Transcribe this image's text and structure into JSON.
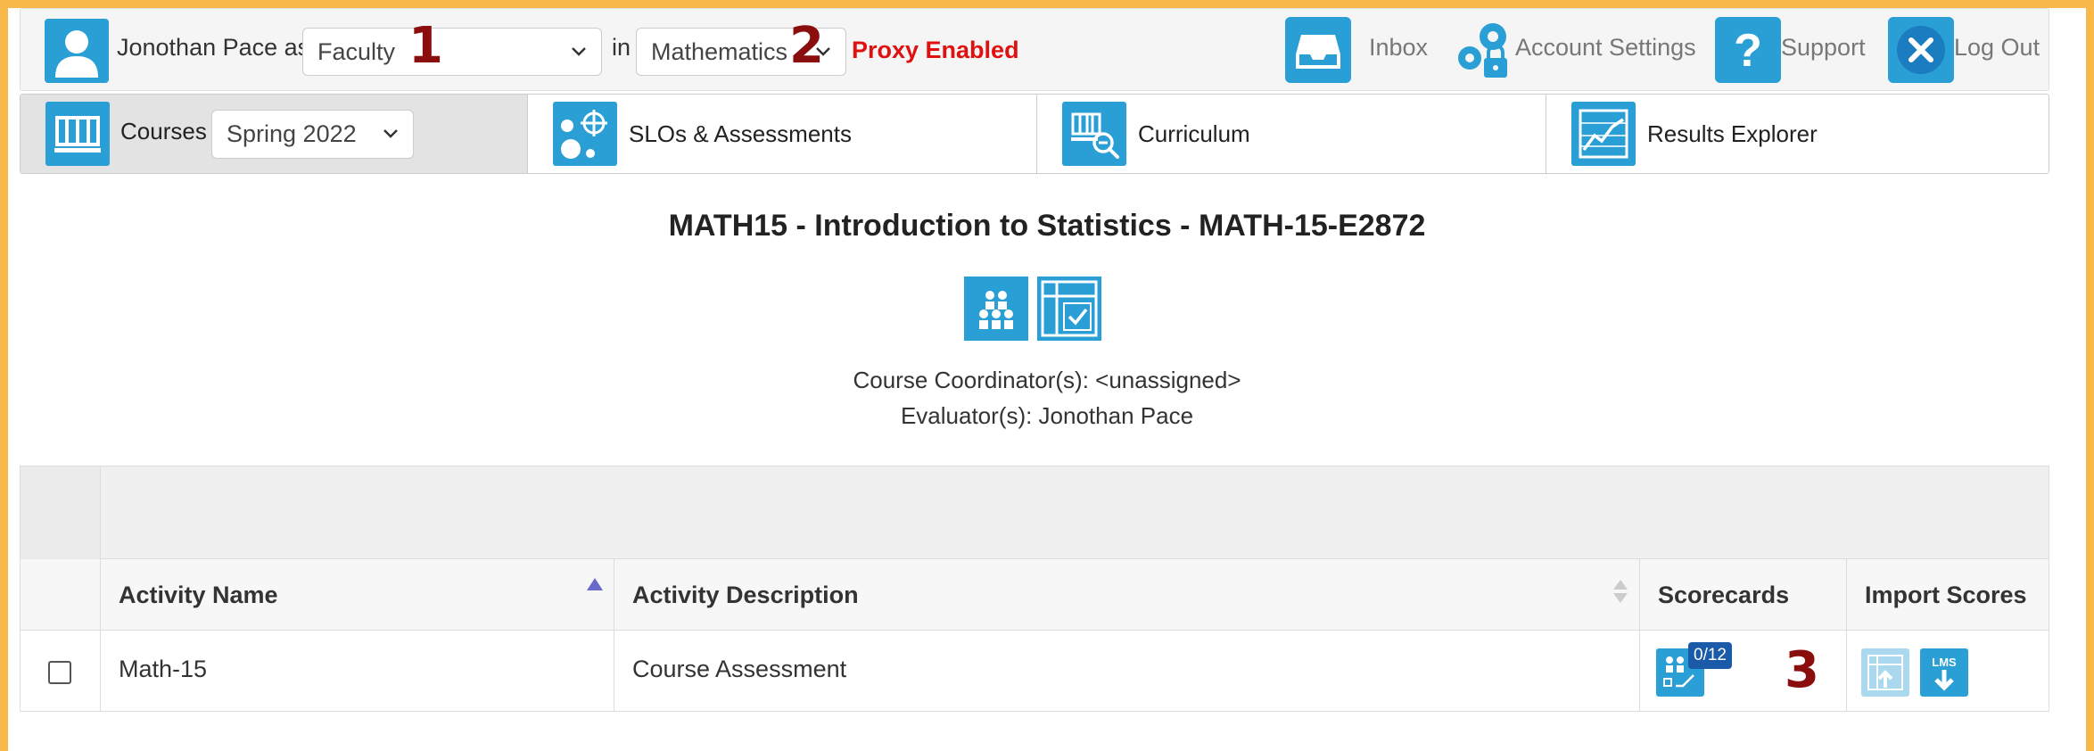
{
  "header": {
    "user_text": "Jonothan Pace as",
    "role_value": "Faculty",
    "in_text": "in",
    "department_value": "Mathematics",
    "proxy_text": "Proxy Enabled",
    "links": {
      "inbox": "Inbox",
      "account_settings": "Account Settings",
      "support": "Support",
      "logout": "Log Out"
    }
  },
  "markers": {
    "m1": "1",
    "m2": "2",
    "m3": "3"
  },
  "nav": {
    "courses_label": "Courses",
    "term_value": "Spring 2022",
    "slos_label": "SLOs & Assessments",
    "curriculum_label": "Curriculum",
    "results_label": "Results Explorer"
  },
  "course": {
    "title": "MATH15 - Introduction to Statistics - MATH-15-E2872",
    "coordinator": "Course Coordinator(s): <unassigned>",
    "evaluator": "Evaluator(s): Jonothan Pace"
  },
  "table": {
    "headers": {
      "activity_name": "Activity Name",
      "activity_description": "Activity Description",
      "scorecards": "Scorecards",
      "import_scores": "Import Scores"
    },
    "rows": [
      {
        "activity_name": "Math-15",
        "activity_description": "Course Assessment",
        "scorecard_badge": "0/12",
        "lms_label": "LMS"
      }
    ]
  },
  "colors": {
    "accent": "#2a9fd6",
    "frame": "#f9b94a",
    "proxy": "#e01010",
    "marker": "#8b0e0e",
    "badge": "#1b5aa8"
  },
  "icons": {
    "avatar": "user-avatar-icon",
    "inbox": "inbox-tray-icon",
    "account_settings": "gears-lock-icon",
    "support": "question-icon",
    "logout": "close-icon",
    "courses": "courses-columns-icon",
    "slos": "target-bubbles-icon",
    "curriculum": "curriculum-magnify-icon",
    "results": "line-chart-icon"
  }
}
